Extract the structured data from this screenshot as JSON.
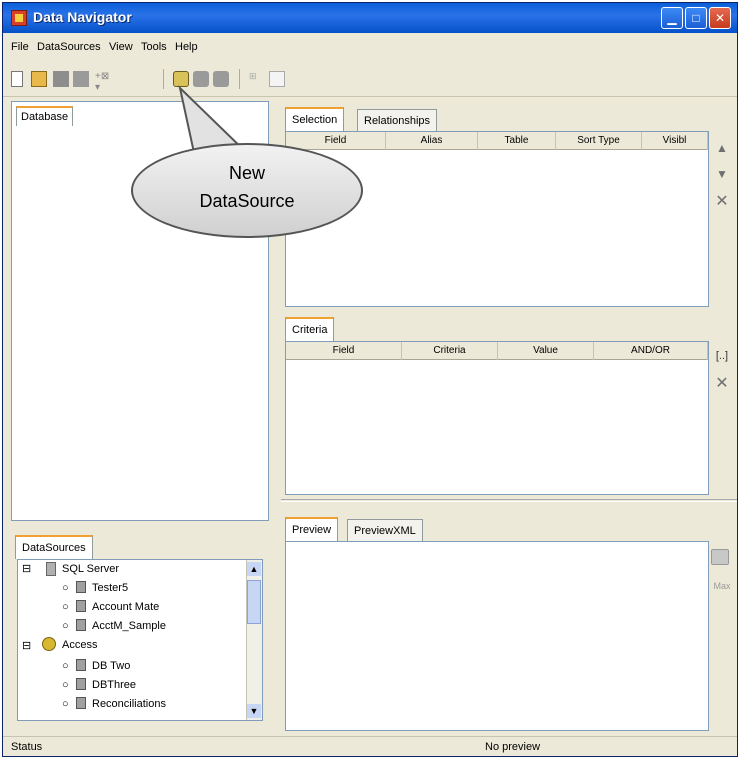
{
  "window": {
    "title": "Data Navigator"
  },
  "menus": [
    "File",
    "DataSources",
    "View",
    "Tools",
    "Help"
  ],
  "database_tab": "Database",
  "selection": {
    "tabs": [
      "Selection",
      "Relationships"
    ],
    "columns": [
      "Field",
      "Alias",
      "Table",
      "Sort Type",
      "Visibl"
    ]
  },
  "criteria": {
    "tab": "Criteria",
    "columns": [
      "Field",
      "Criteria",
      "Value",
      "AND/OR"
    ],
    "button": "[..]"
  },
  "preview": {
    "tabs": [
      "Preview",
      "PreviewXML"
    ],
    "side_label": "Max"
  },
  "datasources": {
    "tab": "DataSources",
    "groups": [
      {
        "label": "SQL Server",
        "items": [
          "Tester5",
          "Account Mate",
          "AcctM_Sample"
        ]
      },
      {
        "label": "Access",
        "items": [
          "DB Two",
          "DBThree",
          "Reconciliations"
        ]
      }
    ]
  },
  "status": {
    "left": "Status",
    "right": "No preview"
  },
  "callout": {
    "line1": "New",
    "line2": "DataSource"
  }
}
